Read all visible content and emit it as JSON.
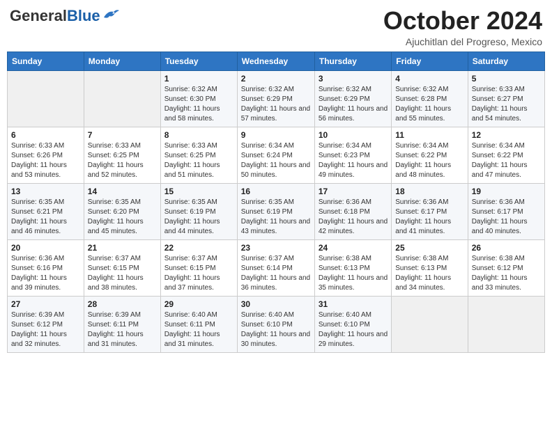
{
  "header": {
    "logo_general": "General",
    "logo_blue": "Blue",
    "month": "October 2024",
    "location": "Ajuchitlan del Progreso, Mexico"
  },
  "days_of_week": [
    "Sunday",
    "Monday",
    "Tuesday",
    "Wednesday",
    "Thursday",
    "Friday",
    "Saturday"
  ],
  "weeks": [
    [
      {
        "day": "",
        "info": ""
      },
      {
        "day": "",
        "info": ""
      },
      {
        "day": "1",
        "info": "Sunrise: 6:32 AM\nSunset: 6:30 PM\nDaylight: 11 hours and 58 minutes."
      },
      {
        "day": "2",
        "info": "Sunrise: 6:32 AM\nSunset: 6:29 PM\nDaylight: 11 hours and 57 minutes."
      },
      {
        "day": "3",
        "info": "Sunrise: 6:32 AM\nSunset: 6:29 PM\nDaylight: 11 hours and 56 minutes."
      },
      {
        "day": "4",
        "info": "Sunrise: 6:32 AM\nSunset: 6:28 PM\nDaylight: 11 hours and 55 minutes."
      },
      {
        "day": "5",
        "info": "Sunrise: 6:33 AM\nSunset: 6:27 PM\nDaylight: 11 hours and 54 minutes."
      }
    ],
    [
      {
        "day": "6",
        "info": "Sunrise: 6:33 AM\nSunset: 6:26 PM\nDaylight: 11 hours and 53 minutes."
      },
      {
        "day": "7",
        "info": "Sunrise: 6:33 AM\nSunset: 6:25 PM\nDaylight: 11 hours and 52 minutes."
      },
      {
        "day": "8",
        "info": "Sunrise: 6:33 AM\nSunset: 6:25 PM\nDaylight: 11 hours and 51 minutes."
      },
      {
        "day": "9",
        "info": "Sunrise: 6:34 AM\nSunset: 6:24 PM\nDaylight: 11 hours and 50 minutes."
      },
      {
        "day": "10",
        "info": "Sunrise: 6:34 AM\nSunset: 6:23 PM\nDaylight: 11 hours and 49 minutes."
      },
      {
        "day": "11",
        "info": "Sunrise: 6:34 AM\nSunset: 6:22 PM\nDaylight: 11 hours and 48 minutes."
      },
      {
        "day": "12",
        "info": "Sunrise: 6:34 AM\nSunset: 6:22 PM\nDaylight: 11 hours and 47 minutes."
      }
    ],
    [
      {
        "day": "13",
        "info": "Sunrise: 6:35 AM\nSunset: 6:21 PM\nDaylight: 11 hours and 46 minutes."
      },
      {
        "day": "14",
        "info": "Sunrise: 6:35 AM\nSunset: 6:20 PM\nDaylight: 11 hours and 45 minutes."
      },
      {
        "day": "15",
        "info": "Sunrise: 6:35 AM\nSunset: 6:19 PM\nDaylight: 11 hours and 44 minutes."
      },
      {
        "day": "16",
        "info": "Sunrise: 6:35 AM\nSunset: 6:19 PM\nDaylight: 11 hours and 43 minutes."
      },
      {
        "day": "17",
        "info": "Sunrise: 6:36 AM\nSunset: 6:18 PM\nDaylight: 11 hours and 42 minutes."
      },
      {
        "day": "18",
        "info": "Sunrise: 6:36 AM\nSunset: 6:17 PM\nDaylight: 11 hours and 41 minutes."
      },
      {
        "day": "19",
        "info": "Sunrise: 6:36 AM\nSunset: 6:17 PM\nDaylight: 11 hours and 40 minutes."
      }
    ],
    [
      {
        "day": "20",
        "info": "Sunrise: 6:36 AM\nSunset: 6:16 PM\nDaylight: 11 hours and 39 minutes."
      },
      {
        "day": "21",
        "info": "Sunrise: 6:37 AM\nSunset: 6:15 PM\nDaylight: 11 hours and 38 minutes."
      },
      {
        "day": "22",
        "info": "Sunrise: 6:37 AM\nSunset: 6:15 PM\nDaylight: 11 hours and 37 minutes."
      },
      {
        "day": "23",
        "info": "Sunrise: 6:37 AM\nSunset: 6:14 PM\nDaylight: 11 hours and 36 minutes."
      },
      {
        "day": "24",
        "info": "Sunrise: 6:38 AM\nSunset: 6:13 PM\nDaylight: 11 hours and 35 minutes."
      },
      {
        "day": "25",
        "info": "Sunrise: 6:38 AM\nSunset: 6:13 PM\nDaylight: 11 hours and 34 minutes."
      },
      {
        "day": "26",
        "info": "Sunrise: 6:38 AM\nSunset: 6:12 PM\nDaylight: 11 hours and 33 minutes."
      }
    ],
    [
      {
        "day": "27",
        "info": "Sunrise: 6:39 AM\nSunset: 6:12 PM\nDaylight: 11 hours and 32 minutes."
      },
      {
        "day": "28",
        "info": "Sunrise: 6:39 AM\nSunset: 6:11 PM\nDaylight: 11 hours and 31 minutes."
      },
      {
        "day": "29",
        "info": "Sunrise: 6:40 AM\nSunset: 6:11 PM\nDaylight: 11 hours and 31 minutes."
      },
      {
        "day": "30",
        "info": "Sunrise: 6:40 AM\nSunset: 6:10 PM\nDaylight: 11 hours and 30 minutes."
      },
      {
        "day": "31",
        "info": "Sunrise: 6:40 AM\nSunset: 6:10 PM\nDaylight: 11 hours and 29 minutes."
      },
      {
        "day": "",
        "info": ""
      },
      {
        "day": "",
        "info": ""
      }
    ]
  ]
}
